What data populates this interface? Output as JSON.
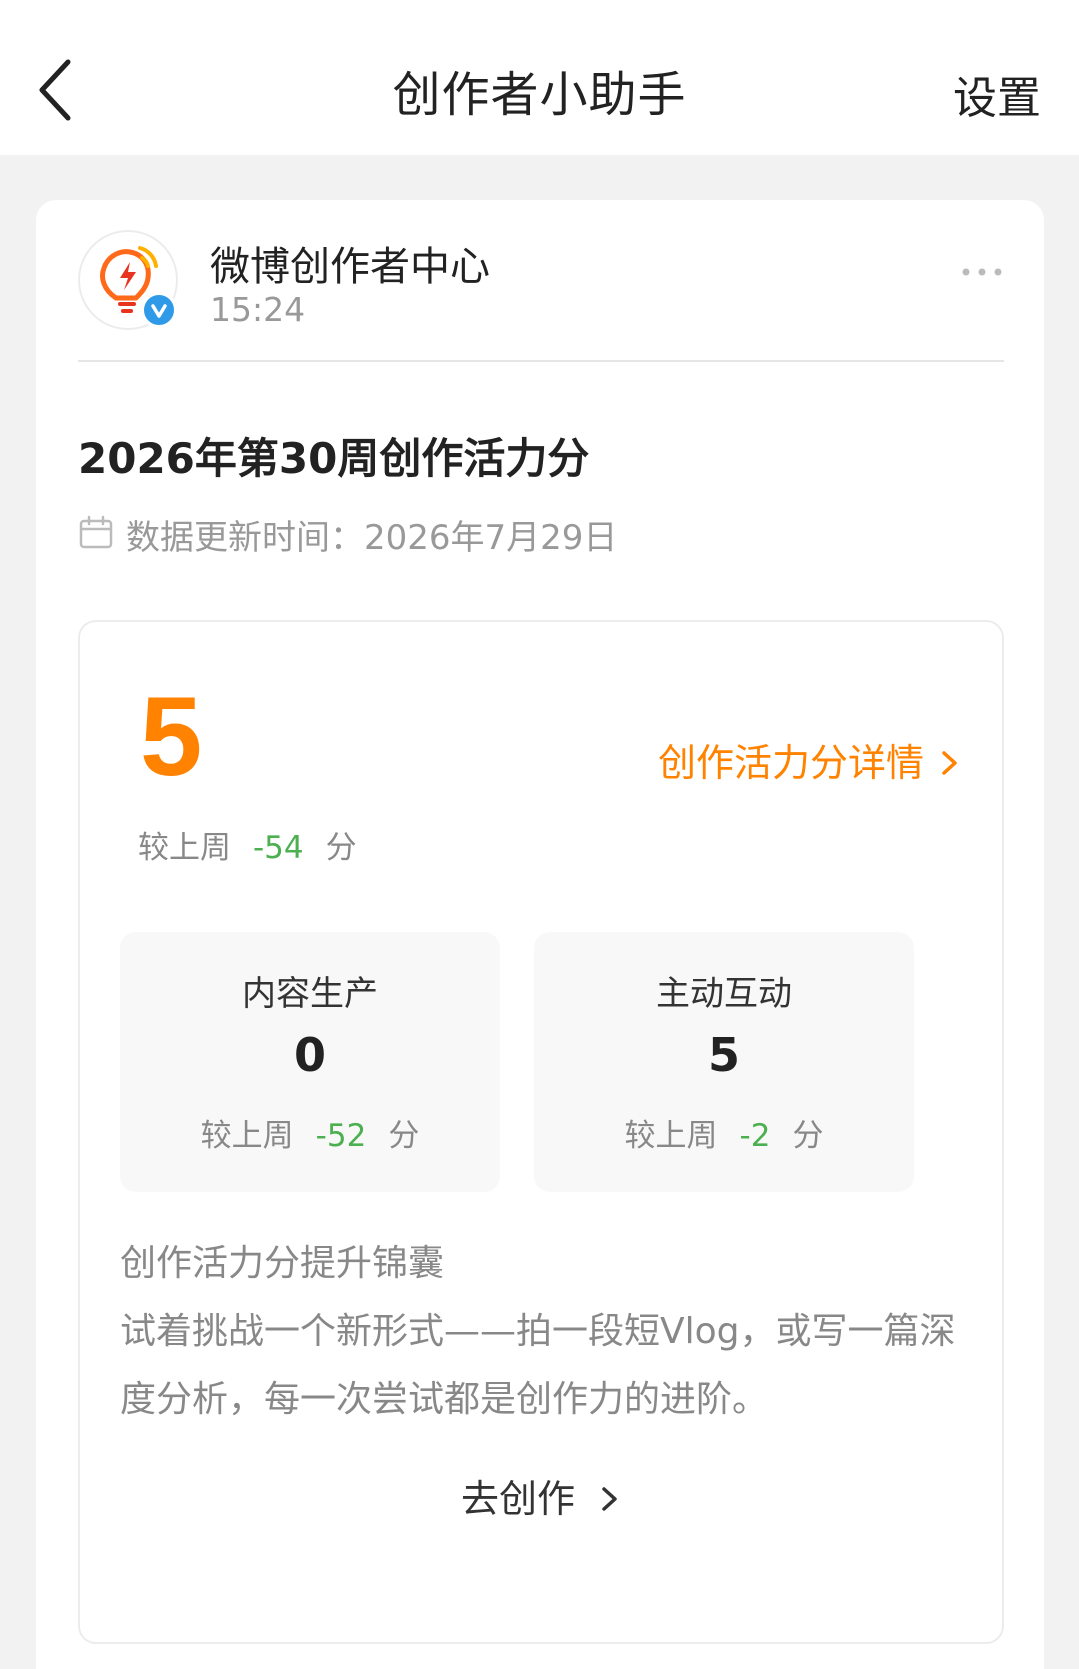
{
  "header": {
    "title": "创作者小助手",
    "settings_label": "设置"
  },
  "post": {
    "author_name": "微博创作者中心",
    "time": "15:24"
  },
  "report": {
    "title": "2026年第30周创作活力分",
    "update_label": "数据更新时间：2026年7月29日",
    "score": "5",
    "detail_link": "创作活力分详情",
    "compare_prefix": "较上周",
    "compare_delta": "-54",
    "compare_unit": "分",
    "stats": [
      {
        "label": "内容生产",
        "value": "0",
        "compare_prefix": "较上周",
        "delta": "-52",
        "unit": "分"
      },
      {
        "label": "主动互动",
        "value": "5",
        "compare_prefix": "较上周",
        "delta": "-2",
        "unit": "分"
      }
    ],
    "tips_title": "创作活力分提升锦囊",
    "tips_body": "试着挑战一个新形式——拍一段短Vlog，或写一篇深度分析，每一次尝试都是创作力的进阶。",
    "go_create_label": "去创作"
  },
  "colors": {
    "accent": "#ff8200",
    "delta_green": "#4caf50",
    "verified_blue": "#2f9ae8"
  },
  "icons": {
    "back": "chevron-left-icon",
    "more": "more-dots-icon",
    "calendar": "calendar-icon",
    "avatar": "lightbulb-bolt-logo",
    "verified": "verified-badge-icon"
  }
}
